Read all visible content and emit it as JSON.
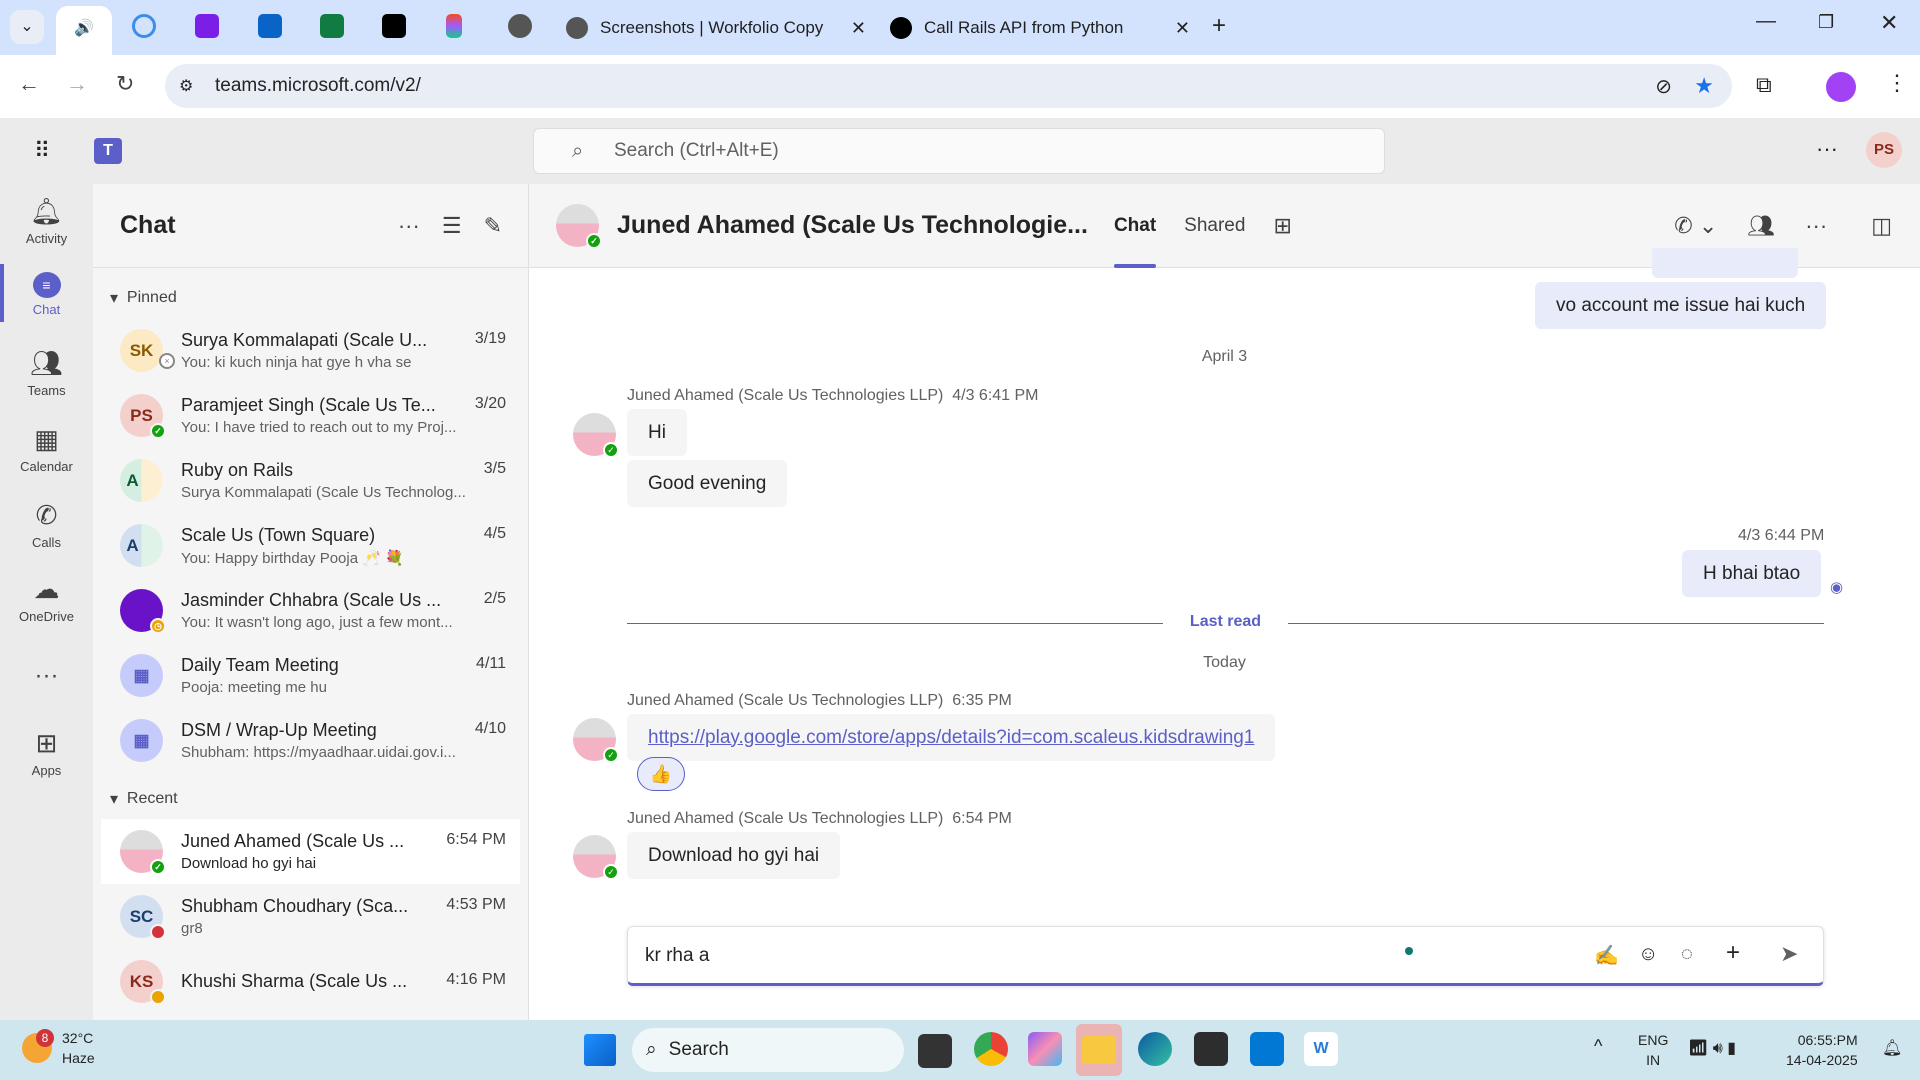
{
  "browser": {
    "tabs": [
      {
        "title": "Screenshots | Workfolio Copy"
      },
      {
        "title": "Call Rails API from Python"
      }
    ],
    "url": "teams.microsoft.com/v2/"
  },
  "teams": {
    "search_placeholder": "Search (Ctrl+Alt+E)",
    "user_initials": "PS",
    "rail": [
      {
        "label": "Activity"
      },
      {
        "label": "Chat"
      },
      {
        "label": "Teams"
      },
      {
        "label": "Calendar"
      },
      {
        "label": "Calls"
      },
      {
        "label": "OneDrive"
      },
      {
        "label": "Apps"
      }
    ],
    "list": {
      "title": "Chat",
      "pinned_label": "Pinned",
      "recent_label": "Recent",
      "pinned": [
        {
          "initials": "SK",
          "name": "Surya Kommalapati (Scale U...",
          "date": "3/19",
          "preview": "You: ki kuch ninja hat gye h vha se"
        },
        {
          "initials": "PS",
          "name": "Paramjeet Singh (Scale Us Te...",
          "date": "3/20",
          "preview": "You: I have tried to reach out to my Proj..."
        },
        {
          "initials": "A",
          "name": "Ruby on Rails",
          "date": "3/5",
          "preview": "Surya Kommalapati (Scale Us Technolog..."
        },
        {
          "initials": "A",
          "name": "Scale Us (Town Square)",
          "date": "4/5",
          "preview": "You: Happy birthday Pooja 🥂 💐"
        },
        {
          "initials": "",
          "name": "Jasminder Chhabra (Scale Us ...",
          "date": "2/5",
          "preview": "You: It wasn't long ago, just a few mont..."
        },
        {
          "initials": "",
          "name": "Daily Team Meeting",
          "date": "4/11",
          "preview": "Pooja: meeting me hu"
        },
        {
          "initials": "",
          "name": "DSM / Wrap-Up Meeting",
          "date": "4/10",
          "preview": "Shubham: https://myaadhaar.uidai.gov.i..."
        }
      ],
      "recent": [
        {
          "initials": "",
          "name": "Juned Ahamed (Scale Us ...",
          "date": "6:54 PM",
          "preview": "Download ho gyi hai"
        },
        {
          "initials": "SC",
          "name": "Shubham Choudhary (Sca...",
          "date": "4:53 PM",
          "preview": "gr8"
        },
        {
          "initials": "KS",
          "name": "Khushi Sharma (Scale Us ...",
          "date": "4:16 PM",
          "preview": ""
        }
      ]
    },
    "chat": {
      "title": "Juned Ahamed (Scale Us Technologie...",
      "tab_chat": "Chat",
      "tab_shared": "Shared",
      "messages": {
        "m0": "vo account me issue hai kuch",
        "date1": "April 3",
        "sender": "Juned Ahamed (Scale Us Technologies LLP)",
        "t1": "4/3 6:41 PM",
        "m1": "Hi",
        "m2": "Good evening",
        "t2": "4/3 6:44 PM",
        "m3": "H bhai btao",
        "last_read": "Last read",
        "date2": "Today",
        "t3": "6:35 PM",
        "link": "https://play.google.com/store/apps/details?id=com.scaleus.kidsdrawing1",
        "reaction": "👍",
        "t4": "6:54 PM",
        "m4": "Download ho gyi hai"
      },
      "composer_value": "kr rha a"
    }
  },
  "taskbar": {
    "weather_temp": "32°C",
    "weather_desc": "Haze",
    "weather_badge": "8",
    "search": "Search",
    "lang1": "ENG",
    "lang2": "IN",
    "time": "06:55:PM",
    "date": "14-04-2025"
  },
  "colors": {
    "accent": "#5b5fc7",
    "online": "#13a10e",
    "away": "#eaa300",
    "busy": "#d13438"
  }
}
